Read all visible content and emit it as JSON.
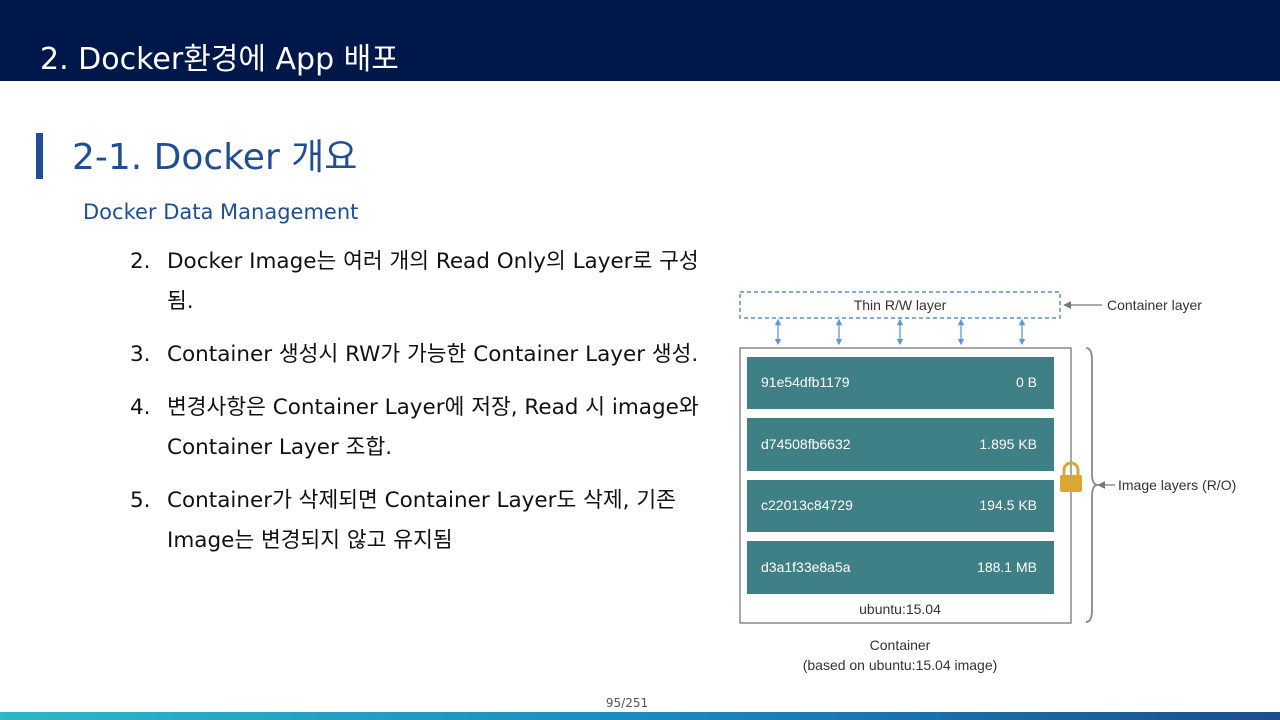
{
  "header": {
    "title": "2.  Docker환경에 App 배포"
  },
  "section": {
    "title": "2-1. Docker 개요"
  },
  "subsection": {
    "title": "Docker Data Management"
  },
  "bullets": [
    {
      "num": "2.",
      "text": "Docker Image는 여러 개의 Read Only의 Layer로 구성됨."
    },
    {
      "num": "3.",
      "text": "Container 생성시 RW가 가능한 Container Layer 생성."
    },
    {
      "num": "4.",
      "text": "변경사항은 Container Layer에 저장, Read 시 image와 Container Layer 조합."
    },
    {
      "num": "5.",
      "text": "Container가 삭제되면 Container Layer도 삭제, 기존 Image는 변경되지 않고 유지됨"
    }
  ],
  "diagram": {
    "thin_layer": "Thin R/W layer",
    "container_layer_label": "Container layer",
    "image_layers_label": "Image layers (R/O)",
    "layers": [
      {
        "id": "91e54dfb1179",
        "size": "0 B"
      },
      {
        "id": "d74508fb6632",
        "size": "1.895 KB"
      },
      {
        "id": "c22013c84729",
        "size": "194.5 KB"
      },
      {
        "id": "d3a1f33e8a5a",
        "size": "188.1 MB"
      }
    ],
    "base_image": "ubuntu:15.04",
    "caption_line1": "Container",
    "caption_line2": "(based on ubuntu:15.04 image)",
    "colors": {
      "layer": "#3f7f86",
      "border": "#8a8a8a",
      "arrow": "#5b9bd5",
      "lock": "#d9a832"
    }
  },
  "footer": {
    "page": "95/251"
  }
}
